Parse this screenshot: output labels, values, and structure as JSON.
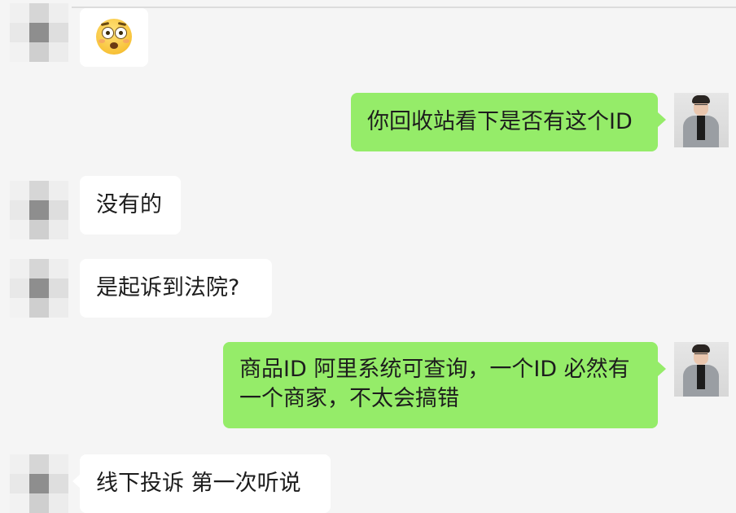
{
  "chat": {
    "messages": [
      {
        "from": "other",
        "kind": "sticker",
        "sticker": "flushed-face-emoji"
      },
      {
        "from": "self",
        "text": "你回收站看下是否有这个ID"
      },
      {
        "from": "other",
        "text": "没有的"
      },
      {
        "from": "other",
        "text": "是起诉到法院?"
      },
      {
        "from": "self",
        "text": "商品ID 阿里系统可查询，一个ID 必然有一个商家，不太会搞错"
      },
      {
        "from": "other",
        "text": "线下投诉 第一次听说"
      }
    ]
  },
  "colors": {
    "background": "#f5f5f5",
    "self_bubble": "#95ec69",
    "other_bubble": "#ffffff",
    "text": "#1d1d1d"
  }
}
